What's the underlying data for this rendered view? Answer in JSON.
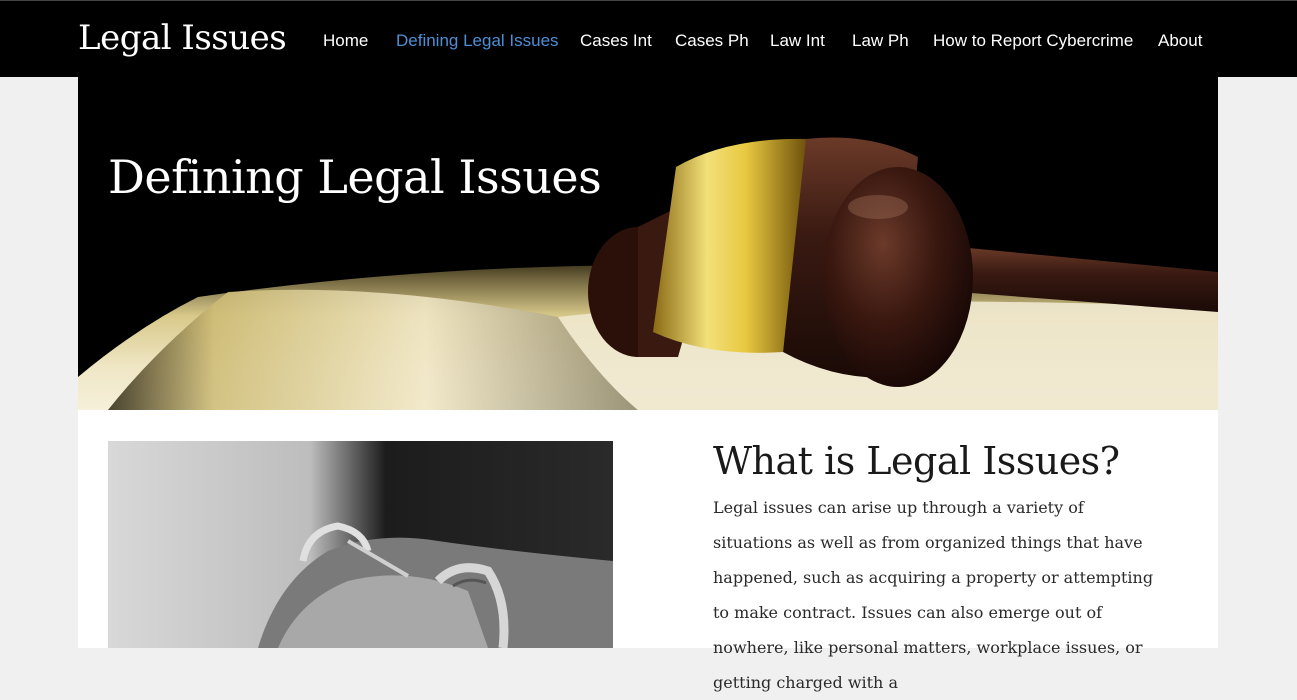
{
  "header": {
    "site_title": "Legal Issues",
    "nav": [
      {
        "label": "Home",
        "active": false
      },
      {
        "label": "Defining Legal Issues",
        "active": true
      },
      {
        "label": "Cases Int",
        "active": false
      },
      {
        "label": "Cases Ph",
        "active": false
      },
      {
        "label": "Law Int",
        "active": false
      },
      {
        "label": "Law Ph",
        "active": false
      },
      {
        "label": "How to Report Cybercrime",
        "active": false
      },
      {
        "label": "About",
        "active": false
      }
    ]
  },
  "hero": {
    "title": "Defining Legal Issues",
    "image": "gavel-on-open-book"
  },
  "main": {
    "image": "handcuffed-hands",
    "heading": "What is Legal Issues?",
    "body": "Legal issues can arise up through a variety of situations as well as from organized things that have happened, such as acquiring a property or attempting to make contract. Issues can also emerge out of nowhere, like personal matters, workplace issues, or getting charged with a"
  },
  "colors": {
    "header_bg": "#000000",
    "nav_active": "#4d8fd6",
    "page_bg": "#f0f0f0",
    "content_bg": "#ffffff"
  }
}
